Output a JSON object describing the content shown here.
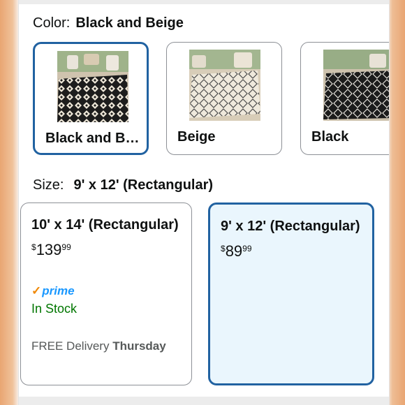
{
  "color": {
    "label": "Color:",
    "selected_value": "Black and Beige",
    "options": [
      {
        "name": "Black and B…"
      },
      {
        "name": "Beige"
      },
      {
        "name": "Black"
      }
    ]
  },
  "size": {
    "label": "Size:",
    "selected_value": "9' x 12' (Rectangular)",
    "options": [
      {
        "name": "10' x 14' (Rectangular)",
        "price_symbol": "$",
        "price_whole": "139",
        "price_fraction": "99",
        "prime_label": "prime",
        "stock": "In Stock",
        "delivery_prefix": "FREE Delivery",
        "delivery_day": "Thursday"
      },
      {
        "name": "9' x 12' (Rectangular)",
        "price_symbol": "$",
        "price_whole": "89",
        "price_fraction": "99"
      }
    ]
  },
  "colors": {
    "selected_border": "#2162a1",
    "selected_fill": "#eaf6fd",
    "stock_green": "#007600",
    "prime_blue": "#1a98ff"
  }
}
